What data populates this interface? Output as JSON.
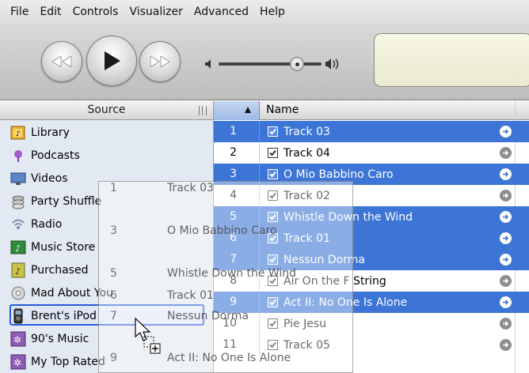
{
  "menu": [
    "File",
    "Edit",
    "Controls",
    "Visualizer",
    "Advanced",
    "Help"
  ],
  "source": {
    "header": "Source",
    "items": [
      {
        "label": "Library",
        "icon": "library-icon"
      },
      {
        "label": "Podcasts",
        "icon": "podcasts-icon"
      },
      {
        "label": "Videos",
        "icon": "videos-icon"
      },
      {
        "label": "Party Shuffle",
        "icon": "party-shuffle-icon"
      },
      {
        "label": "Radio",
        "icon": "radio-icon"
      },
      {
        "label": "Music Store",
        "icon": "music-store-icon"
      },
      {
        "label": "Purchased",
        "icon": "purchased-icon"
      },
      {
        "label": "Mad About You",
        "icon": "cd-icon"
      },
      {
        "label": "Brent's iPod",
        "icon": "ipod-icon",
        "selected": true
      },
      {
        "label": "90's Music",
        "icon": "smart-playlist-icon"
      },
      {
        "label": "My Top Rated",
        "icon": "smart-playlist-icon"
      }
    ]
  },
  "table": {
    "sort_column": "#",
    "name_header": "Name",
    "rows": [
      {
        "num": "1",
        "name": "Track 03",
        "selected": true,
        "checked": true
      },
      {
        "num": "2",
        "name": "Track 04",
        "selected": false,
        "checked": true
      },
      {
        "num": "3",
        "name": "O Mio Babbino Caro",
        "selected": true,
        "checked": true
      },
      {
        "num": "4",
        "name": "Track 02",
        "selected": false,
        "checked": true
      },
      {
        "num": "5",
        "name": "Whistle Down the Wind",
        "selected": true,
        "checked": true
      },
      {
        "num": "6",
        "name": "Track 01",
        "selected": true,
        "checked": true
      },
      {
        "num": "7",
        "name": "Nessun Dorma",
        "selected": true,
        "checked": true
      },
      {
        "num": "8",
        "name": "Air On the F String",
        "selected": false,
        "checked": true
      },
      {
        "num": "9",
        "name": "Act II: No One Is Alone",
        "selected": true,
        "checked": true
      },
      {
        "num": "10",
        "name": "Pie Jesu",
        "selected": false,
        "checked": true
      },
      {
        "num": "11",
        "name": "Track 05",
        "selected": false,
        "checked": true
      }
    ]
  },
  "drag_ghost": {
    "rows": [
      {
        "num": "1",
        "name": "Track 03"
      },
      {
        "num": "3",
        "name": "O Mio Babbino Caro"
      },
      {
        "num": "5",
        "name": "Whistle Down the Wind"
      },
      {
        "num": "6",
        "name": "Track 01"
      },
      {
        "num": "7",
        "name": "Nessun Dorma"
      },
      {
        "num": "9",
        "name": "Act II: No One Is Alone"
      }
    ]
  },
  "colors": {
    "selection": "#3d75d6",
    "source_bg": "#e3e9f2",
    "ipod_highlight": "#2a5bd7"
  }
}
